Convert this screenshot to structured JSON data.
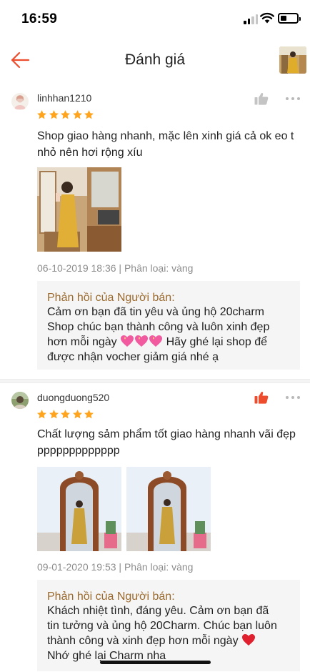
{
  "status_bar": {
    "time": "16:59"
  },
  "header": {
    "title": "Đánh giá",
    "back_icon": "arrow-left-icon"
  },
  "colors": {
    "accent": "#ee4d2d",
    "star": "#ffa41c",
    "reply_heading": "#9a6a2e",
    "meta": "#8d8d8d"
  },
  "reviews": [
    {
      "username": "linhhan1210",
      "rating": 5,
      "liked": false,
      "text": "Shop giao hàng nhanh, mặc lên xinh giá cả ok eo t nhỏ nên hơi rộng xíu",
      "meta": "06-10-2019 18:36 | Phân loại: vàng",
      "seller_reply": {
        "heading": "Phản hồi của Người bán:",
        "line1": "Cảm ơn bạn đã tin yêu và ủng hộ 20charm",
        "line2": "Shop chúc bạn thành công và luôn xinh đẹp",
        "line3a": "hơn mỗi ngày",
        "line3b": "Hãy ghé lại shop để",
        "line4": "được nhận vocher giảm giá nhé ạ"
      }
    },
    {
      "username": "duongduong520",
      "rating": 5,
      "liked": true,
      "text": "Chất lượng sảm phẩm tốt giao hàng nhanh vãi đẹpppppppppppppp",
      "meta": "09-01-2020 19:53 | Phân loại: vàng",
      "seller_reply": {
        "heading": "Phản hồi của Người bán:",
        "line1": "Khách nhiệt tình, đáng yêu. Cảm ơn bạn đã",
        "line2": "tin tưởng và ủng hộ 20Charm. Chúc bạn luôn",
        "line3": "thành công và xinh đẹp hơn mỗi ngày",
        "line4": "Nhớ ghé lại Charm nha"
      }
    }
  ]
}
